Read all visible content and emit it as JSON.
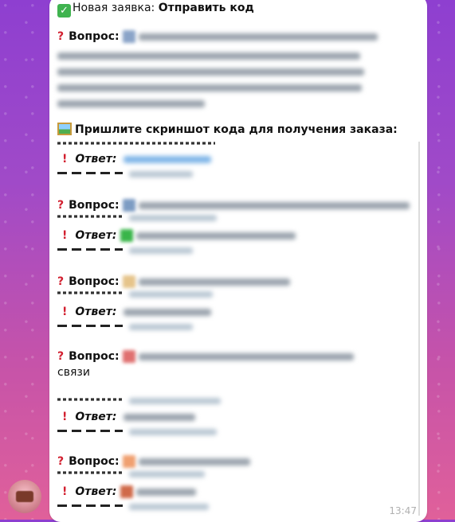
{
  "header": {
    "prefix": "Новая заявка:",
    "title": "Отправить код"
  },
  "labels": {
    "question": "Вопрос:",
    "answer": "Ответ:"
  },
  "instruction": "Пришлите скриншот кода для получения заказа:",
  "wrap_text": "связи",
  "time": "13:47",
  "colors": {
    "bubble": "#ffffff",
    "accent_red": "#d21f2f",
    "background_top": "#8e3fd0",
    "background_bottom": "#e0609a"
  },
  "icons": [
    "check-mark-icon",
    "question-mark-icon",
    "exclamation-mark-icon",
    "framed-picture-icon"
  ]
}
